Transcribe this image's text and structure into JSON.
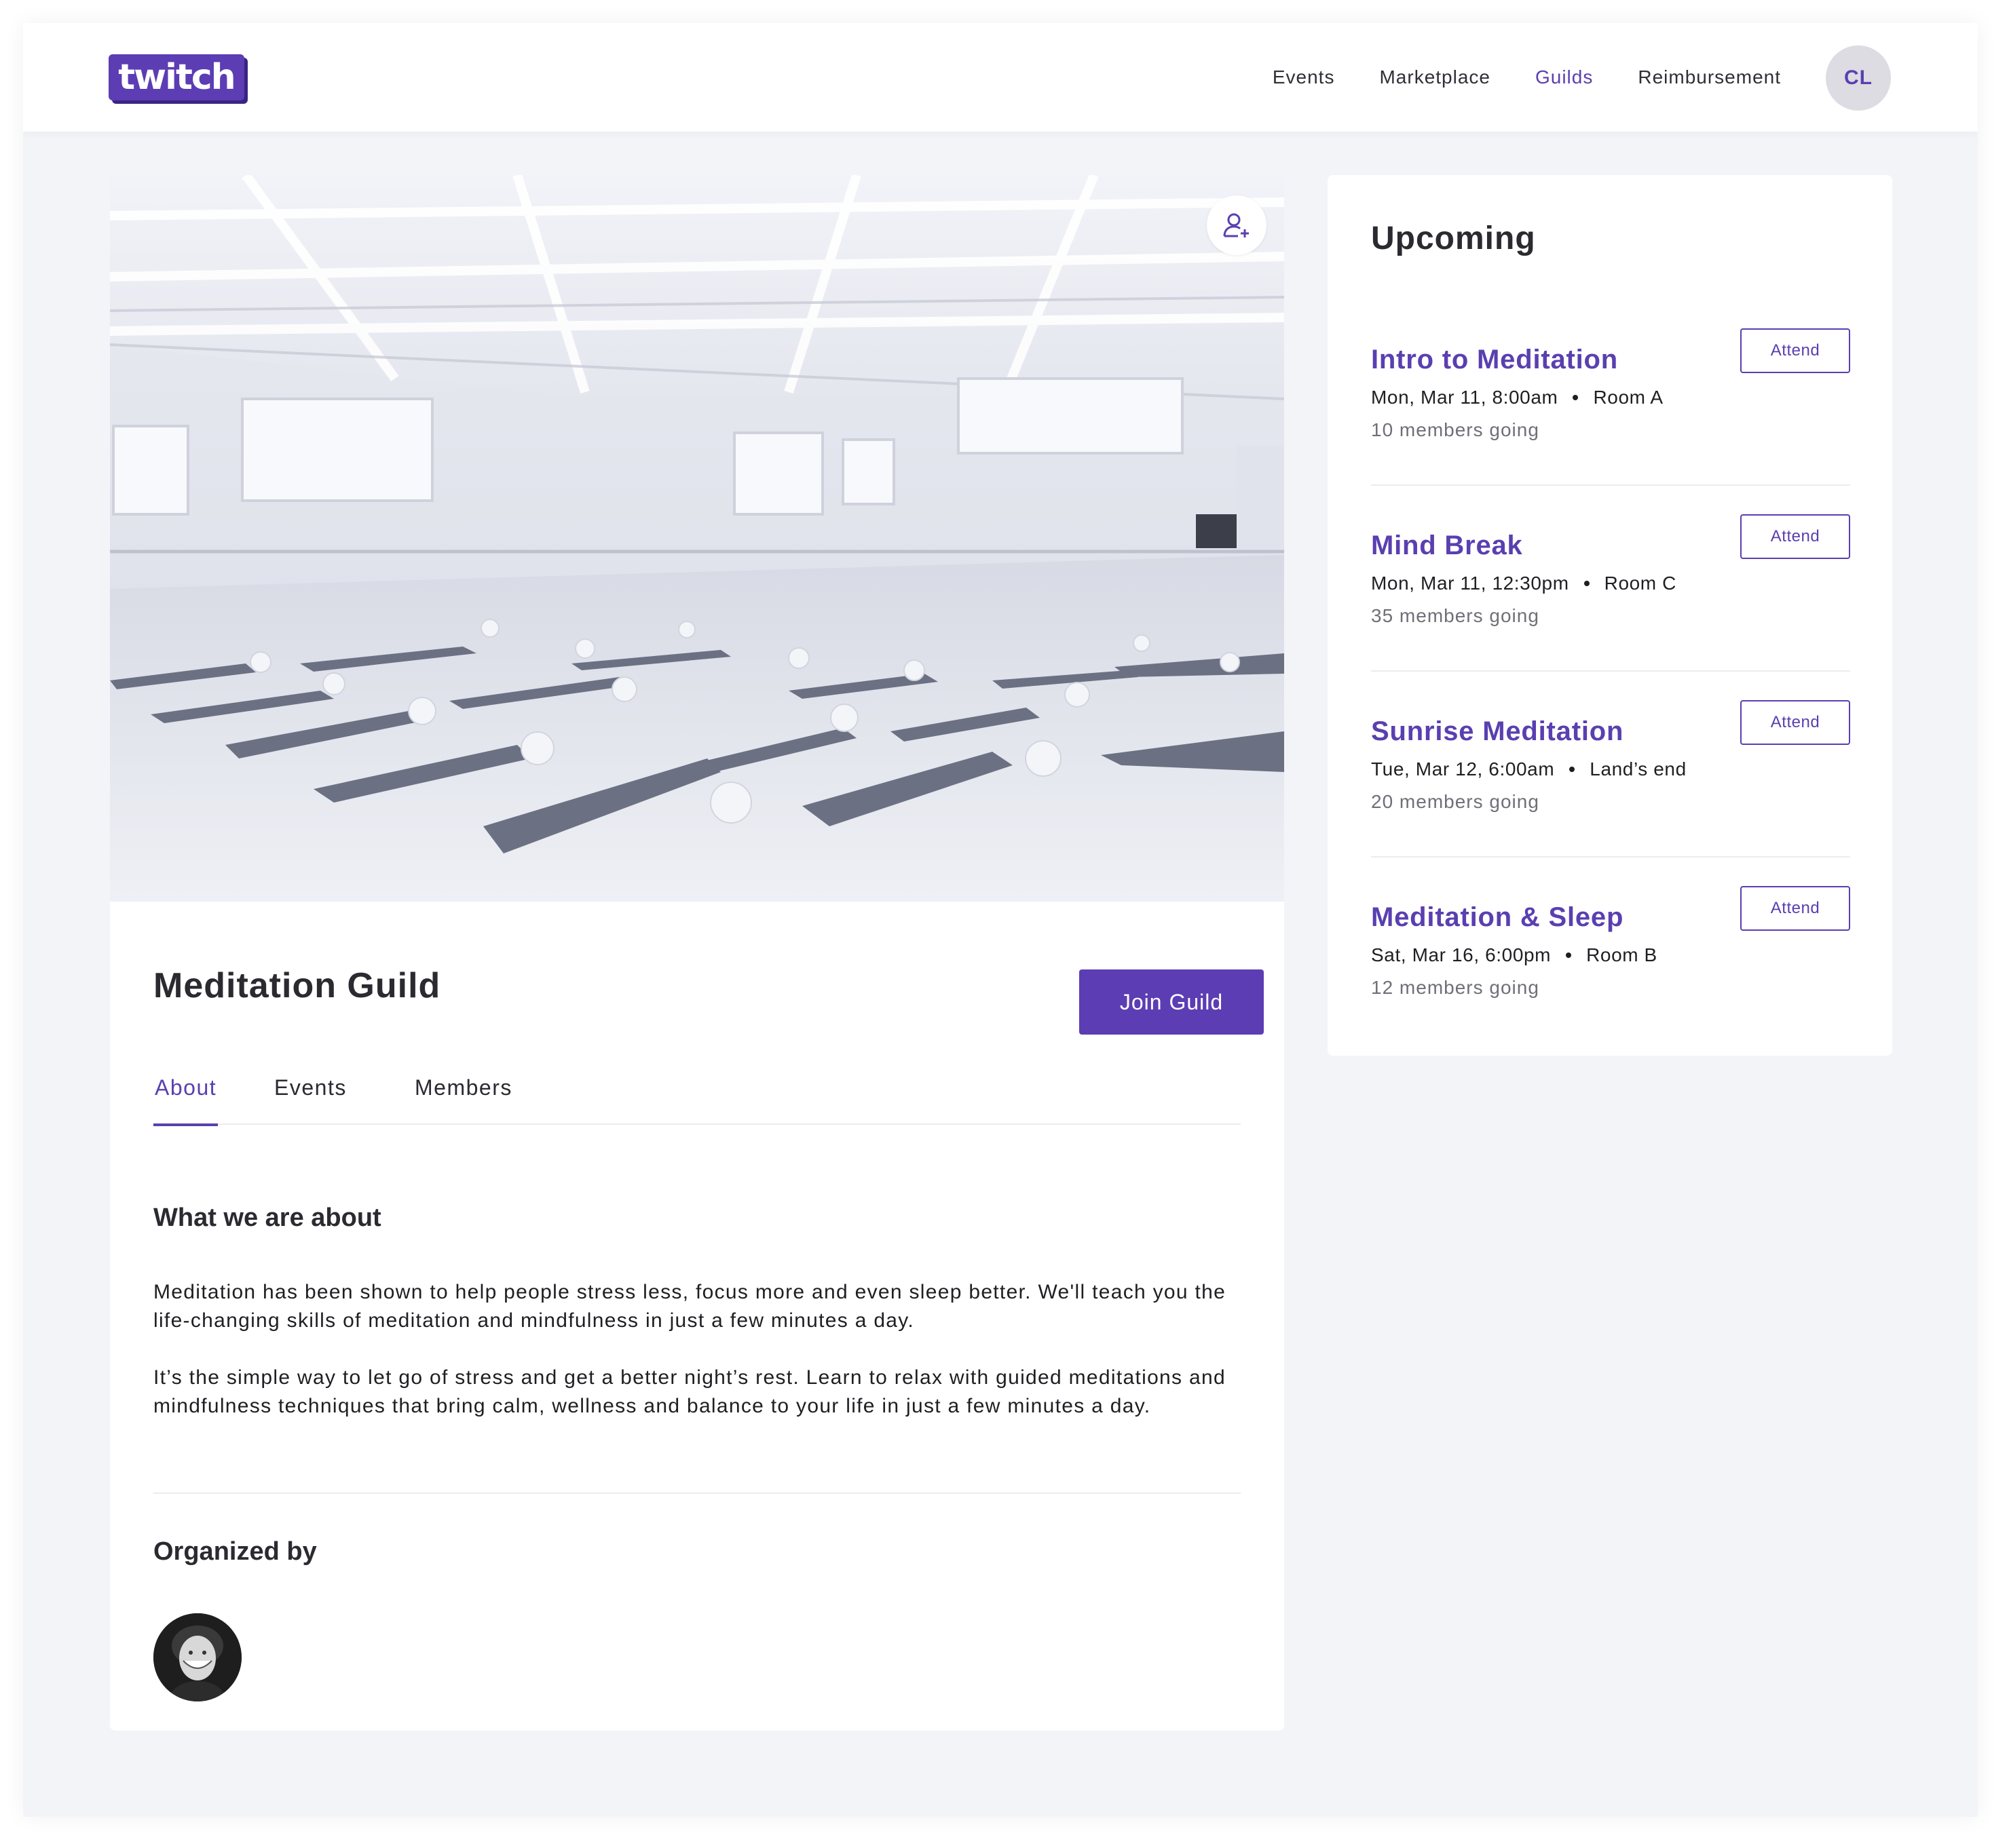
{
  "header": {
    "logo_text": "twitch",
    "nav": [
      {
        "label": "Events",
        "active": false
      },
      {
        "label": "Marketplace",
        "active": false
      },
      {
        "label": "Guilds",
        "active": true
      },
      {
        "label": "Reimbursement",
        "active": false
      }
    ],
    "avatar_initials": "CL"
  },
  "guild": {
    "title": "Meditation Guild",
    "join_label": "Join Guild",
    "follow_icon": "user-plus-icon",
    "tabs": [
      {
        "label": "About",
        "active": true
      },
      {
        "label": "Events",
        "active": false
      },
      {
        "label": "Members",
        "active": false
      }
    ],
    "about_heading": "What we are about",
    "paragraph_1": "Meditation has been shown to help people stress less, focus more and even sleep better. We'll teach you the life-changing skills of meditation and mindfulness in just a few minutes a day.",
    "paragraph_2": "It’s the simple way to let go of stress and get a better night’s rest. Learn to relax with guided meditations and mindfulness techniques that bring calm, wellness and balance to your life in just a few minutes a day.",
    "organized_heading": "Organized by"
  },
  "upcoming": {
    "title": "Upcoming",
    "events": [
      {
        "title": "Intro to Meditation",
        "when": "Mon, Mar 11, 8:00am",
        "where": "Room A",
        "going": "10 members going",
        "attend_label": "Attend"
      },
      {
        "title": "Mind Break",
        "when": "Mon, Mar 11, 12:30pm",
        "where": "Room C",
        "going": "35 members going",
        "attend_label": "Attend"
      },
      {
        "title": "Sunrise Meditation",
        "when": "Tue, Mar 12, 6:00am",
        "where": "Land’s end",
        "going": "20 members going",
        "attend_label": "Attend"
      },
      {
        "title": "Meditation & Sleep",
        "when": "Sat, Mar 16, 6:00pm",
        "where": "Room B",
        "going": "12 members going",
        "attend_label": "Attend"
      }
    ]
  },
  "colors": {
    "accent": "#5a3fb0",
    "background": "#f3f4f8",
    "text": "#1f1f23",
    "muted": "#6f6f78"
  }
}
